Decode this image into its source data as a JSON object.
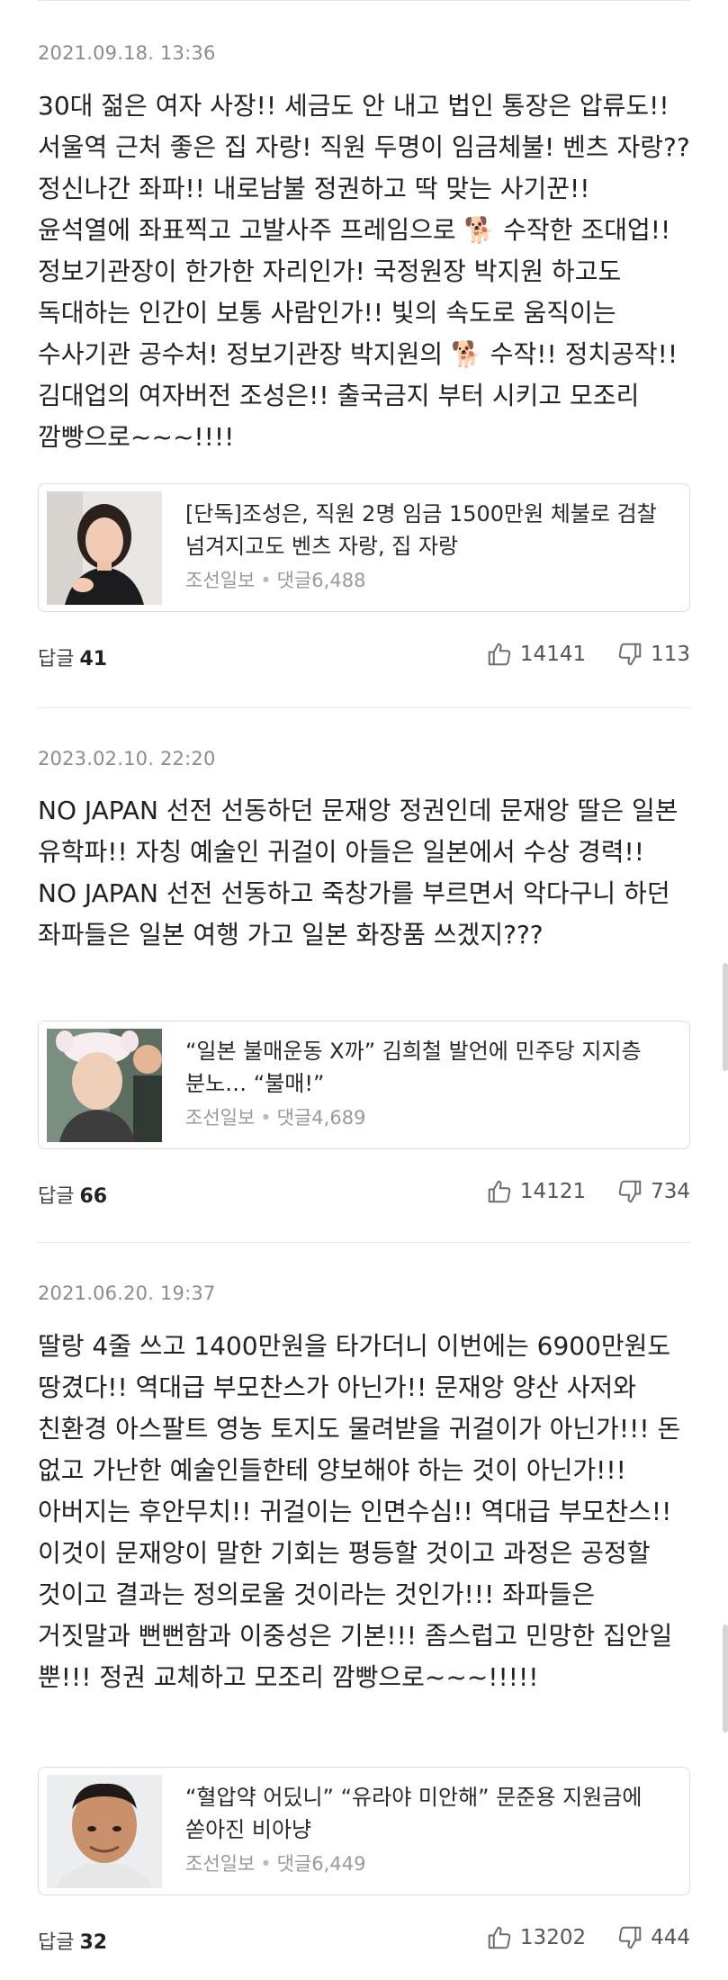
{
  "comments": [
    {
      "timestamp": "2021.09.18. 13:36",
      "body": "30대 젊은 여자 사장!! 세금도 안 내고 법인 통장은 압류도!! 서울역 근처 좋은 집 자랑! 직원 두명이 임금체불! 벤츠 자랑?? 정신나간 좌파!! 내로남불 정권하고 딱 맞는 사기꾼!! 윤석열에 좌표찍고 고발사주 프레임으로 🐕 수작한 조대업!! 정보기관장이 한가한 자리인가! 국정원장 박지원 하고도 독대하는 인간이 보통 사람인가!! 빛의 속도로 움직이는 수사기관 공수처! 정보기관장 박지원의 🐕 수작!! 정치공작!! 김대업의 여자버전 조성은!! 출국금지 부터 시키고 모조리 깜빵으로~~~!!!!",
      "article": {
        "title": "[단독]조성은, 직원 2명 임금 1500만원 체불로 검찰 넘겨지고도 벤츠 자랑, 집 자랑",
        "source": "조선일보",
        "comments": "댓글6,488"
      },
      "reply_label": "답글",
      "reply_count": "41",
      "likes": "14141",
      "dislikes": "113"
    },
    {
      "timestamp": "2023.02.10. 22:20",
      "body": "NO JAPAN 선전 선동하던 문재앙 정권인데 문재앙 딸은 일본 유학파!! 자칭 예술인 귀걸이 아들은 일본에서 수상 경력!! NO JAPAN 선전 선동하고 죽창가를 부르면서 악다구니 하던 좌파들은 일본 여행 가고 일본 화장품 쓰겠지???",
      "article": {
        "title": "“일본 불매운동 X까” 김희철 발언에 민주당 지지층 분노… “불매!”",
        "source": "조선일보",
        "comments": "댓글4,689"
      },
      "reply_label": "답글",
      "reply_count": "66",
      "likes": "14121",
      "dislikes": "734"
    },
    {
      "timestamp": "2021.06.20. 19:37",
      "body": "딸랑 4줄 쓰고 1400만원을 타가더니 이번에는 6900만원도 땅겼다!! 역대급 부모찬스가 아닌가!! 문재앙 양산 사저와 친환경 아스팔트 영농 토지도 물려받을 귀걸이가 아닌가!!! 돈 없고 가난한 예술인들한테 양보해야 하는 것이 아닌가!!! 아버지는 후안무치!! 귀걸이는 인면수심!! 역대급 부모찬스!! 이것이 문재앙이 말한 기회는 평등할 것이고 과정은 공정할 것이고 결과는 정의로울 것이라는 것인가!!! 좌파들은 거짓말과 뻔뻔함과 이중성은 기본!!! 좀스럽고 민망한 집안일 뿐!!! 정권 교체하고 모조리 깜빵으로~~~!!!!!",
      "article": {
        "title": "“혈압약 어딨니” “유라야 미안해” 문준용 지원금에 쏟아진 비아냥",
        "source": "조선일보",
        "comments": "댓글6,449"
      },
      "reply_label": "답글",
      "reply_count": "32",
      "likes": "13202",
      "dislikes": "444"
    }
  ],
  "icons": {
    "like": "thumbs-up-icon",
    "dislike": "thumbs-down-icon"
  },
  "colors": {
    "timestamp": "#8c8c8c",
    "meta": "#9a9a9a",
    "border": "#dcdcdc"
  }
}
